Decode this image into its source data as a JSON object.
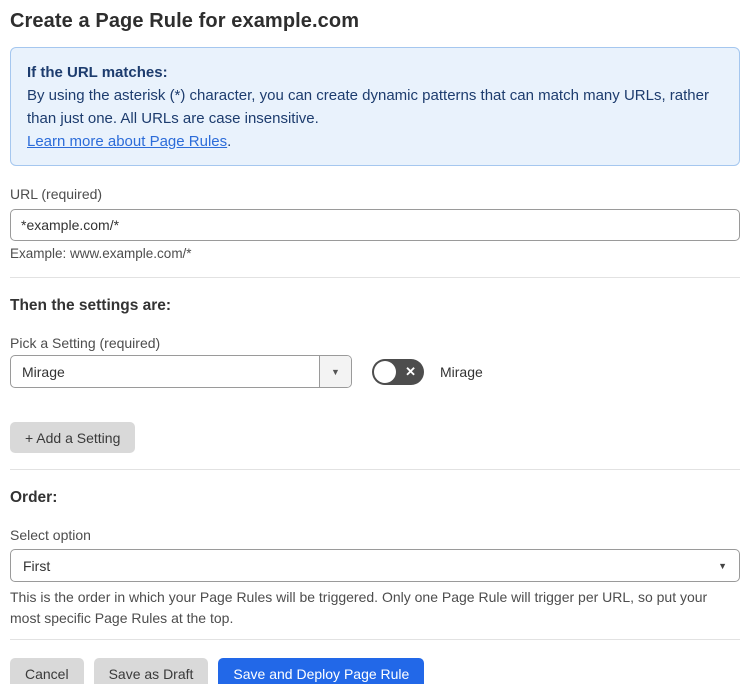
{
  "page": {
    "title": "Create a Page Rule for example.com"
  },
  "info_box": {
    "heading": "If the URL matches:",
    "body": "By using the asterisk (*) character, you can create dynamic patterns that can match many URLs, rather than just one. All URLs are case insensitive.",
    "link_label": "Learn more about Page Rules",
    "link_suffix": "."
  },
  "url_field": {
    "label": "URL (required)",
    "value": "*example.com/*",
    "helper": "Example: www.example.com/*"
  },
  "settings_section": {
    "heading": "Then the settings are:",
    "pick_label": "Pick a Setting (required)",
    "selected_setting": "Mirage",
    "toggle": {
      "state": "off",
      "label": "Mirage"
    },
    "add_setting_label": "+ Add a Setting"
  },
  "order_section": {
    "heading": "Order:",
    "label": "Select option",
    "selected_option": "First",
    "helper": "This is the order in which your Page Rules will be triggered. Only one Page Rule will trigger per URL, so put your most specific Page Rules at the top."
  },
  "footer": {
    "cancel_label": "Cancel",
    "save_draft_label": "Save as Draft",
    "deploy_label": "Save and Deploy Page Rule"
  },
  "icons": {
    "caret_down": "▼",
    "close": "✕"
  },
  "colors": {
    "info_box_bg": "#e9f2fc",
    "info_box_border": "#a5c7ef",
    "info_text": "#1d3c6e",
    "link_blue": "#2c6cd9",
    "primary_button_blue": "#2268e8",
    "grey_button_bg": "#d9d9d9",
    "toggle_off_bg": "#4d4d4d"
  }
}
